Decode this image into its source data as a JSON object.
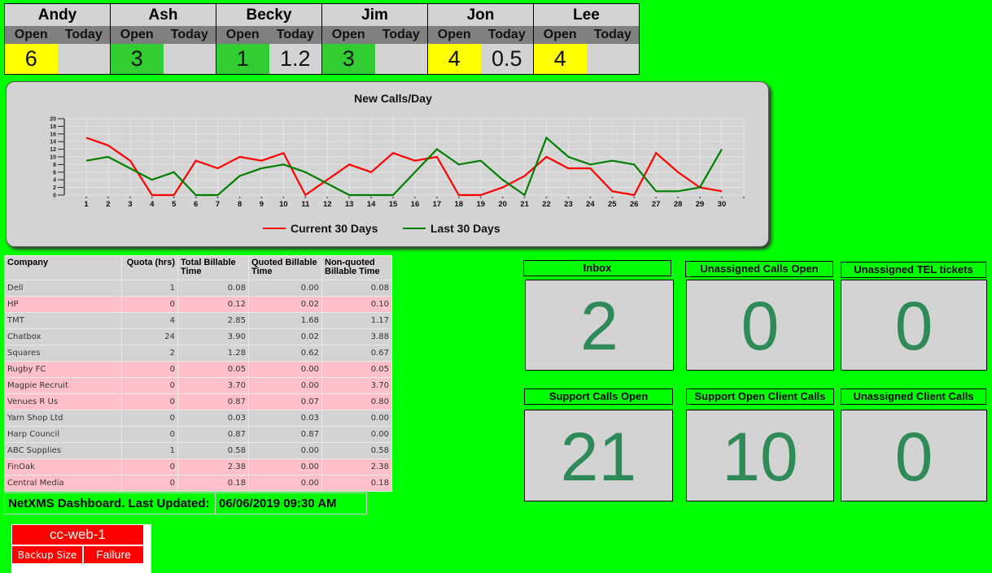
{
  "staff": [
    {
      "name": "Andy",
      "open": "6",
      "today": "",
      "open_color": "#ffff00",
      "today_color": "#d3d3d3"
    },
    {
      "name": "Ash",
      "open": "3",
      "today": "",
      "open_color": "#32cd32",
      "today_color": "#d3d3d3"
    },
    {
      "name": "Becky",
      "open": "1",
      "today": "1.2",
      "open_color": "#32cd32",
      "today_color": "#d3d3d3"
    },
    {
      "name": "Jim",
      "open": "3",
      "today": "",
      "open_color": "#32cd32",
      "today_color": "#d3d3d3"
    },
    {
      "name": "Jon",
      "open": "4",
      "today": "0.5",
      "open_color": "#ffff00",
      "today_color": "#d3d3d3"
    },
    {
      "name": "Lee",
      "open": "4",
      "today": "",
      "open_color": "#ffff00",
      "today_color": "#d3d3d3"
    }
  ],
  "staff_labels": {
    "open": "Open",
    "today": "Today"
  },
  "chart_data": {
    "type": "line",
    "title": "New Calls/Day",
    "xlabel": "",
    "ylabel": "",
    "x": [
      1,
      2,
      3,
      4,
      5,
      6,
      7,
      8,
      9,
      10,
      11,
      12,
      13,
      14,
      15,
      16,
      17,
      18,
      19,
      20,
      21,
      22,
      23,
      24,
      25,
      26,
      27,
      28,
      29,
      30
    ],
    "yticks": [
      0,
      2,
      4,
      6,
      8,
      10,
      12,
      14,
      16,
      18,
      20
    ],
    "ylim": [
      0,
      20
    ],
    "grid": true,
    "legend_position": "bottom-center",
    "series": [
      {
        "name": "Current 30 Days",
        "color": "#ff0000",
        "values": [
          15,
          13,
          9,
          0,
          0,
          9,
          7,
          10,
          9,
          11,
          0,
          4,
          8,
          6,
          11,
          9,
          10,
          0,
          0,
          2,
          5,
          10,
          7,
          7,
          1,
          0,
          11,
          6,
          2,
          1
        ]
      },
      {
        "name": "Last 30 Days",
        "color": "#008000",
        "values": [
          9,
          10,
          7,
          4,
          6,
          0,
          0,
          5,
          7,
          8,
          6,
          3,
          0,
          0,
          0,
          6,
          12,
          8,
          9,
          4,
          0,
          15,
          10,
          8,
          9,
          8,
          1,
          1,
          2,
          12
        ]
      }
    ]
  },
  "billing": {
    "headers": [
      "Company",
      "Quota (hrs)",
      "Total Billable Time",
      "Quoted Billable Time",
      "Non-quoted Billable Time"
    ],
    "rows": [
      {
        "company": "Dell",
        "quota": "1",
        "total": "0.08",
        "quoted": "0.00",
        "nonquoted": "0.08",
        "highlight": false
      },
      {
        "company": "HP",
        "quota": "0",
        "total": "0.12",
        "quoted": "0.02",
        "nonquoted": "0.10",
        "highlight": true
      },
      {
        "company": "TMT",
        "quota": "4",
        "total": "2.85",
        "quoted": "1.68",
        "nonquoted": "1.17",
        "highlight": false
      },
      {
        "company": "Chatbox",
        "quota": "24",
        "total": "3.90",
        "quoted": "0.02",
        "nonquoted": "3.88",
        "highlight": false
      },
      {
        "company": "Squares",
        "quota": "2",
        "total": "1.28",
        "quoted": "0.62",
        "nonquoted": "0.67",
        "highlight": false
      },
      {
        "company": "Rugby FC",
        "quota": "0",
        "total": "0.05",
        "quoted": "0.00",
        "nonquoted": "0.05",
        "highlight": true
      },
      {
        "company": "Magpie Recruit",
        "quota": "0",
        "total": "3.70",
        "quoted": "0.00",
        "nonquoted": "3.70",
        "highlight": true
      },
      {
        "company": "Venues R Us",
        "quota": "0",
        "total": "0.87",
        "quoted": "0.07",
        "nonquoted": "0.80",
        "highlight": true
      },
      {
        "company": "Yarn Shop Ltd",
        "quota": "0",
        "total": "0.03",
        "quoted": "0.03",
        "nonquoted": "0.00",
        "highlight": false
      },
      {
        "company": "Harp Council",
        "quota": "0",
        "total": "0.87",
        "quoted": "0.87",
        "nonquoted": "0.00",
        "highlight": false
      },
      {
        "company": "ABC Supplies",
        "quota": "1",
        "total": "0.58",
        "quoted": "0.00",
        "nonquoted": "0.58",
        "highlight": false
      },
      {
        "company": "FinOak",
        "quota": "0",
        "total": "2.38",
        "quoted": "0.00",
        "nonquoted": "2.38",
        "highlight": true
      },
      {
        "company": "Central Media",
        "quota": "0",
        "total": "0.18",
        "quoted": "0.00",
        "nonquoted": "0.18",
        "highlight": true
      }
    ]
  },
  "footer": {
    "label": "NetXMS Dashboard.  Last Updated:",
    "timestamp": "06/06/2019 09:30 AM"
  },
  "backup": {
    "host": "cc-web-1",
    "metric": "Backup Size",
    "status": "Failure",
    "status_color": "#ff0000"
  },
  "stats": [
    {
      "label": "Inbox",
      "value": "2"
    },
    {
      "label": "Unassigned Calls Open",
      "value": "0"
    },
    {
      "label": "Unassigned TEL tickets",
      "value": "0"
    },
    {
      "label": "Support Calls Open",
      "value": "21"
    },
    {
      "label": "Support Open Client Calls",
      "value": "10"
    },
    {
      "label": "Unassigned Client Calls",
      "value": "0"
    }
  ]
}
